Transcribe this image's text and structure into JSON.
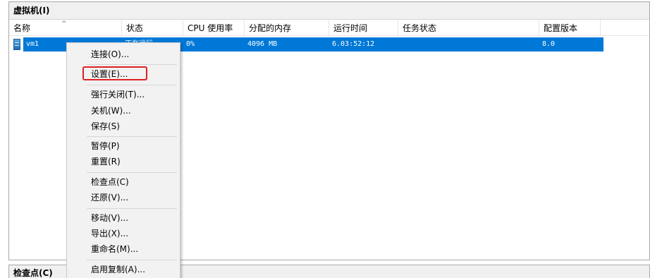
{
  "vm_panel": {
    "title": "虚拟机(I)",
    "columns": [
      "名称",
      "状态",
      "CPU 使用率",
      "分配的内存",
      "运行时间",
      "任务状态",
      "配置版本"
    ],
    "rows": [
      {
        "name": "vm1",
        "status": "正在运行",
        "cpu": "0%",
        "memory": "4096 MB",
        "uptime": "6.03:52:12",
        "task_status": "",
        "version": "8.0"
      }
    ]
  },
  "checkpoint_panel": {
    "title": "检查点(C)"
  },
  "context_menu": {
    "items": [
      "连接(O)...",
      "设置(E)...",
      "强行关闭(T)...",
      "关机(W)...",
      "保存(S)",
      "暂停(P)",
      "重置(R)",
      "检查点(C)",
      "还原(V)...",
      "移动(V)...",
      "导出(X)...",
      "重命名(M)...",
      "启用复制(A)..."
    ]
  },
  "colors": {
    "selection": "#0078d7",
    "highlight_box": "#e02020"
  }
}
